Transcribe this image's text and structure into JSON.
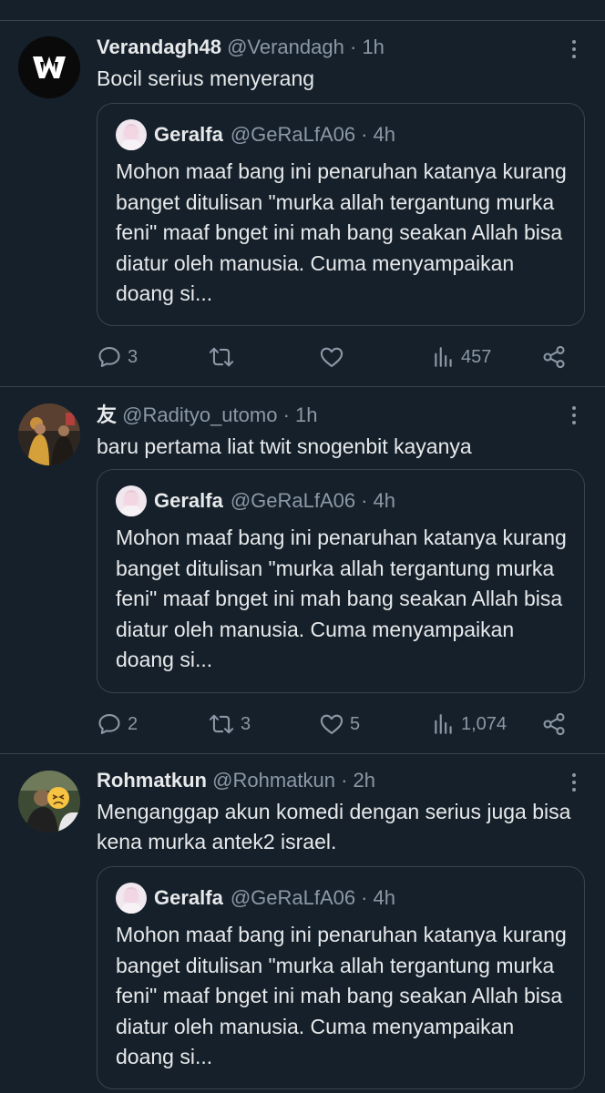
{
  "colors": {
    "background": "#15202b",
    "divider": "#38444d",
    "text": "#e7e9ea",
    "muted": "#8b98a5"
  },
  "tweets": [
    {
      "display_name": "Verandagh48",
      "handle": "@Verandagh",
      "separator": "·",
      "time": "1h",
      "text": "Bocil serius menyerang",
      "quote": {
        "display_name": "Geralfa",
        "handle": "@GeRaLfA06",
        "separator": "·",
        "time": "4h",
        "text": "Mohon maaf bang ini penaruhan katanya kurang banget ditulisan \"murka allah tergantung murka feni\" maaf bnget ini mah bang seakan Allah bisa diatur oleh manusia. Cuma menyampaikan doang si..."
      },
      "actions": {
        "replies": "3",
        "retweets": "",
        "likes": "",
        "views": "457"
      },
      "icons": {
        "avatar": "predator-logo-avatar",
        "more": "more-icon"
      }
    },
    {
      "display_name": "友",
      "handle": "@Radityo_utomo",
      "separator": "·",
      "time": "1h",
      "text": "baru pertama liat twit snogenbit kayanya",
      "quote": {
        "display_name": "Geralfa",
        "handle": "@GeRaLfA06",
        "separator": "·",
        "time": "4h",
        "text": "Mohon maaf bang ini penaruhan katanya kurang banget ditulisan \"murka allah tergantung murka feni\" maaf bnget ini mah bang seakan Allah bisa diatur oleh manusia. Cuma menyampaikan doang si..."
      },
      "actions": {
        "replies": "2",
        "retweets": "3",
        "likes": "5",
        "views": "1,074"
      },
      "icons": {
        "avatar": "photo-avatar",
        "more": "more-icon"
      }
    },
    {
      "display_name": "Rohmatkun",
      "handle": "@Rohmatkun",
      "separator": "·",
      "time": "2h",
      "text": "Menganggap akun komedi dengan serius juga bisa kena murka antek2 israel.",
      "quote": {
        "display_name": "Geralfa",
        "handle": "@GeRaLfA06",
        "separator": "·",
        "time": "4h",
        "text": "Mohon maaf bang ini penaruhan katanya kurang banget ditulisan \"murka allah tergantung murka feni\" maaf bnget ini mah bang seakan Allah bisa diatur oleh manusia. Cuma menyampaikan doang si..."
      },
      "actions": {
        "replies": "",
        "retweets": "",
        "likes": "",
        "views": ""
      },
      "icons": {
        "avatar": "photo-avatar-with-emoji",
        "more": "more-icon"
      }
    }
  ]
}
